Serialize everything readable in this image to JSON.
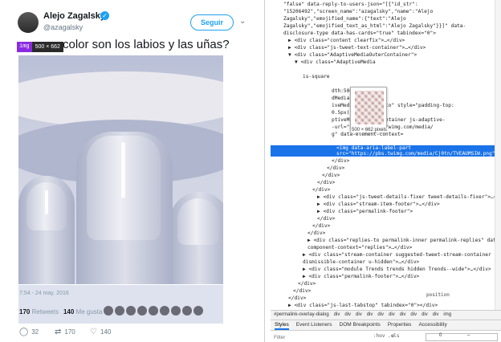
{
  "tweet": {
    "name": "Alejo Zagalsky",
    "handle": "@azagalsky",
    "follow_label": "Seguir",
    "img_tag": "img",
    "img_dims": "500 × 662",
    "text": "color son los labios y las uñas?",
    "time": "7:54 - 24 may. 2016",
    "retweets_count": "170",
    "retweets_label": "Retweets",
    "likes_count": "140",
    "likes_label": "Me gusta",
    "reply_count": "32",
    "rt_count": "170",
    "like_count": "140"
  },
  "devtools": {
    "lines": [
      {
        "indent": 16,
        "html": "\"false\" data-reply-to-users-json=\"[{\"id_str\":"
      },
      {
        "indent": 16,
        "html": "\"15206492\",\"screen_name\":\"azagalsky\",\"name\":\"Alejo"
      },
      {
        "indent": 16,
        "html": "Zagalsky\",\"emojified_name\":{\"text\":\"Alejo"
      },
      {
        "indent": 16,
        "html": "Zagalsky\",\"emojified_text_as_html\":\"Alejo Zagalsky\"}}]\" data-"
      },
      {
        "indent": 16,
        "html": "disclosure-type data-has-cards=\"true\" tabindex=\"0\">"
      },
      {
        "indent": 22,
        "html": "▶ <div class=\"content clearfix\">…</div>"
      },
      {
        "indent": 22,
        "html": "▶ <div class=\"js-tweet-text-container\">…</div>"
      },
      {
        "indent": 22,
        "html": "▼ <div class=\"AdaptiveMediaOuterContainer\">"
      },
      {
        "indent": 30,
        "html": "▼ <div class=\"AdaptiveMedia"
      },
      {
        "indent": 40,
        "html": ""
      },
      {
        "indent": 40,
        "html": "is-square"
      },
      {
        "indent": 40,
        "html": ""
      },
      {
        "indent": 76,
        "html": "dth:500px;\">"
      },
      {
        "indent": 76,
        "html": "dMedia-container\">"
      },
      {
        "indent": 76,
        "html": "iveMedia-singlePhoto\" style=\"padding-top:"
      },
      {
        "indent": 76,
        "html": "0.5px);\">"
      },
      {
        "indent": 76,
        "html": "ptiveMedia-photoContainer js-adaptive-"
      },
      {
        "indent": 76,
        "html": "-url=\"https://pbs.twimg.com/media/"
      },
      {
        "indent": 76,
        "html": "g\" data-element-context="
      },
      {
        "indent": 76,
        "html": ""
      },
      {
        "indent": 82,
        "html": "<img data-aria-label-part src=\"https://pbs.twimg.com/media/Cj0tn/TVEAUMSIW.png\" alt> == $0",
        "selected": true
      },
      {
        "indent": 76,
        "html": "</div>"
      },
      {
        "indent": 70,
        "html": "</div>"
      },
      {
        "indent": 64,
        "html": "</div>"
      },
      {
        "indent": 58,
        "html": "</div>"
      },
      {
        "indent": 52,
        "html": "</div>"
      },
      {
        "indent": 58,
        "html": "▶ <div class=\"js-tweet-details-fixer tweet-details-fixer\">…</div>"
      },
      {
        "indent": 58,
        "html": "▶ <div class=\"stream-item-footer\">…</div>"
      },
      {
        "indent": 58,
        "html": "▶ <div class=\"permalink-footer\">"
      },
      {
        "indent": 58,
        "html": "</div>"
      },
      {
        "indent": 52,
        "html": "</div>"
      },
      {
        "indent": 46,
        "html": "</div>"
      },
      {
        "indent": 46,
        "html": "▶ <div class=\"replies-to  permalink-inner permalink-replies\" data-"
      },
      {
        "indent": 46,
        "html": "component-context=\"replies\">…</div>"
      },
      {
        "indent": 40,
        "html": "▶ <div class=\"stream-container suggested-tweet-stream-container"
      },
      {
        "indent": 40,
        "html": "dismissible-container u-hidden\">…</div>"
      },
      {
        "indent": 40,
        "html": "▶ <div class=\"module Trends trends hidden Trends--wide\">…</div>"
      },
      {
        "indent": 40,
        "html": "▶ <div class=\"permalink-footer\">…</div>"
      },
      {
        "indent": 34,
        "html": "</div>"
      },
      {
        "indent": 28,
        "html": "</div>"
      },
      {
        "indent": 22,
        "html": "</div>"
      },
      {
        "indent": 22,
        "html": "▶ <div class=\"js-last-tabstop\" tabindex=\"0\"></div>"
      }
    ],
    "preview_caption": "500 × 662 pixels",
    "crumbs": [
      "#permalink-overlay-dialog",
      "div",
      "div",
      "div",
      "div",
      "div",
      "div",
      "div",
      "div",
      "div",
      "div",
      "img"
    ],
    "tabs": [
      "Styles",
      "Event Listeners",
      "DOM Breakpoints",
      "Properties",
      "Accessibility"
    ],
    "filter_placeholder": "Filter",
    "hov_label": ":hov .cls",
    "side_label": "position",
    "box_label": "position",
    "box_value": "0",
    "box_dash": "–"
  }
}
